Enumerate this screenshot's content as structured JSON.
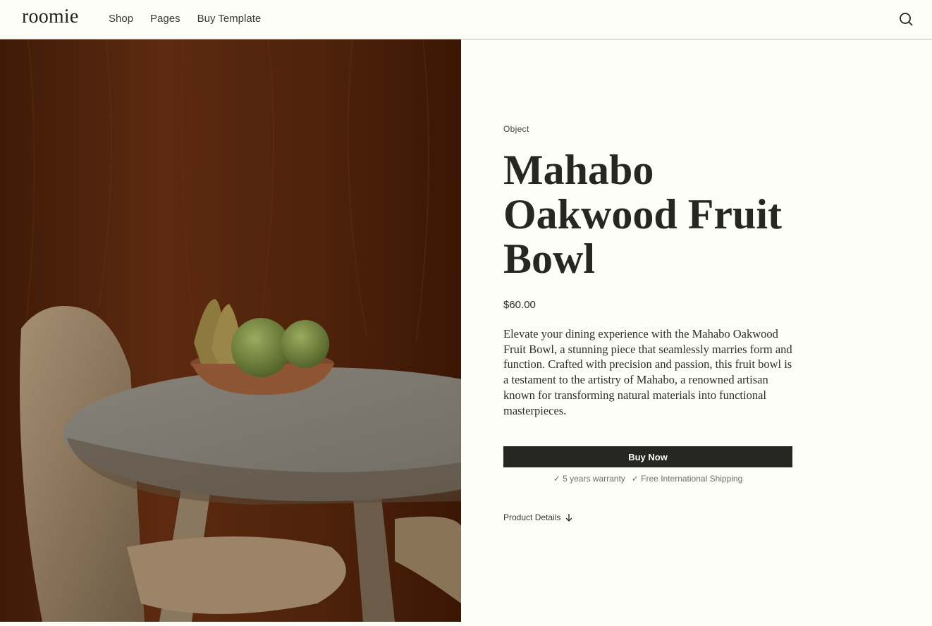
{
  "header": {
    "logo": "roomie",
    "nav": [
      "Shop",
      "Pages",
      "Buy Template"
    ]
  },
  "icons": {
    "search": "search-icon",
    "arrow": "arrow-down-icon",
    "check": "check-icon"
  },
  "product": {
    "category": "Object",
    "title": "Mahabo Oakwood Fruit Bowl",
    "price": "$60.00",
    "description": "Elevate your dining experience with the Mahabo Oakwood Fruit Bowl, a stunning piece that seamlessly marries form and function. Crafted with precision and passion, this fruit bowl is a testament to the artistry of Mahabo, a renowned artisan known for transforming natural materials into functional masterpieces.",
    "buy_label": "Buy Now",
    "perks": [
      "✓ 5 years warranty",
      "✓ Free International Shipping"
    ],
    "details_label": "Product Details"
  },
  "colors": {
    "background": "#fdfdf8",
    "text": "#262622",
    "button": "#262623",
    "wood_wall": "#5a2a10"
  }
}
